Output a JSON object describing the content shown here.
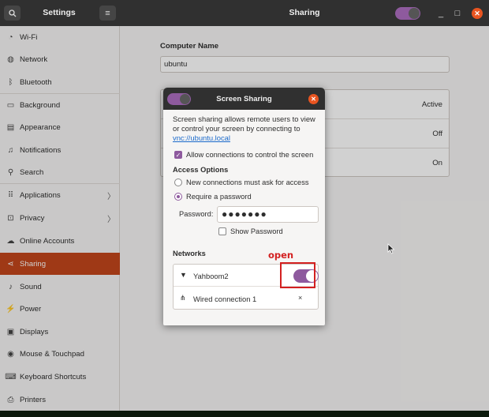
{
  "titlebar": {
    "left_title": "Settings",
    "title": "Sharing",
    "search_icon": "search-icon",
    "menu_icon": "hamburger-icon",
    "minimize_glyph": "_",
    "maximize_glyph": "□",
    "close_glyph": "✕"
  },
  "sidebar": {
    "items": [
      {
        "label": "Wi-Fi",
        "icon": "wifi-icon"
      },
      {
        "label": "Network",
        "icon": "network-icon"
      },
      {
        "label": "Bluetooth",
        "icon": "bluetooth-icon"
      },
      {
        "label": "Background",
        "icon": "background-icon"
      },
      {
        "label": "Appearance",
        "icon": "appearance-icon"
      },
      {
        "label": "Notifications",
        "icon": "notifications-icon"
      },
      {
        "label": "Search",
        "icon": "search-icon"
      },
      {
        "label": "Applications",
        "icon": "applications-icon"
      },
      {
        "label": "Privacy",
        "icon": "privacy-icon"
      },
      {
        "label": "Online Accounts",
        "icon": "cloud-icon"
      },
      {
        "label": "Sharing",
        "icon": "share-icon"
      },
      {
        "label": "Sound",
        "icon": "music-note-icon"
      },
      {
        "label": "Power",
        "icon": "power-icon"
      },
      {
        "label": "Displays",
        "icon": "display-icon"
      },
      {
        "label": "Mouse & Touchpad",
        "icon": "mouse-icon"
      },
      {
        "label": "Keyboard Shortcuts",
        "icon": "keyboard-icon"
      },
      {
        "label": "Printers",
        "icon": "printer-icon"
      }
    ]
  },
  "main": {
    "computer_name_label": "Computer Name",
    "computer_name_value": "ubuntu",
    "services": [
      {
        "status": "Active"
      },
      {
        "status": "Off"
      },
      {
        "status": "On"
      }
    ]
  },
  "dialog": {
    "title": "Screen Sharing",
    "description": "Screen sharing allows remote users to view or control your screen by connecting to",
    "link": "vnc://ubuntu.local",
    "allow_control_label": "Allow connections to control the screen",
    "allow_control_checked": true,
    "access_options_label": "Access Options",
    "option_ask": "New connections must ask for access",
    "option_password": "Require a password",
    "selected_option": "Require a password",
    "password_label": "Password:",
    "password_value": "●●●●●●●",
    "show_password_label": "Show Password",
    "show_password_checked": false,
    "networks_label": "Networks",
    "networks": [
      {
        "name": "Yahboom2",
        "icon": "wifi-icon",
        "enabled": true
      },
      {
        "name": "Wired connection 1",
        "icon": "wired-network-icon",
        "remove": "×"
      }
    ]
  },
  "annotation": {
    "text": "open",
    "color": "#d32020"
  },
  "colors": {
    "accent": "#8e5a9e",
    "selected": "#c2461b",
    "close": "#e95420",
    "headerbar": "#303030"
  }
}
